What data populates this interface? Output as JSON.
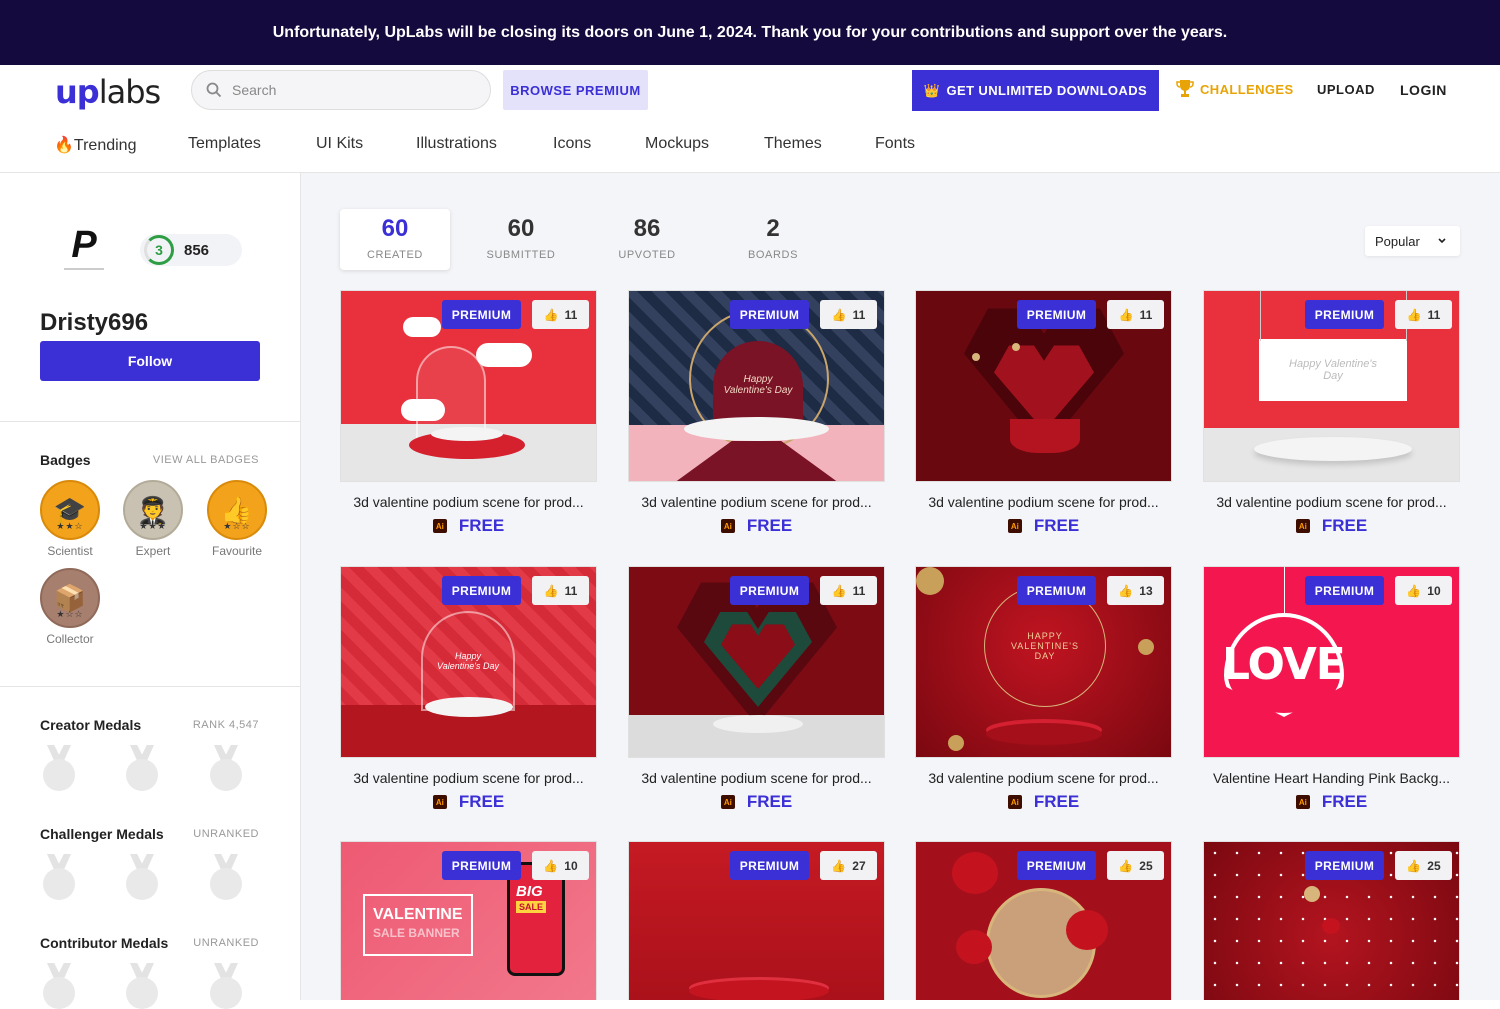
{
  "banner": {
    "text": "Unfortunately, UpLabs will be closing its doors on June 1, 2024. Thank you for your contributions and support over the years."
  },
  "header": {
    "logo_up": "up",
    "logo_labs": "labs",
    "search_placeholder": "Search",
    "browse_premium": "BROWSE PREMIUM",
    "get_unlimited": "GET UNLIMITED DOWNLOADS",
    "challenges": "CHALLENGES",
    "upload": "UPLOAD",
    "login": "LOGIN"
  },
  "categories": [
    "Trending",
    "Templates",
    "UI Kits",
    "Illustrations",
    "Icons",
    "Mockups",
    "Themes",
    "Fonts"
  ],
  "profile": {
    "avatar_letter": "P",
    "level": "3",
    "points": "856",
    "username": "Dristy696",
    "follow_label": "Follow"
  },
  "badges": {
    "title": "Badges",
    "view_all": "VIEW ALL BADGES",
    "items": [
      {
        "label": "Scientist",
        "icon": "graduation-cap-icon",
        "color": "#f2a21b"
      },
      {
        "label": "Expert",
        "icon": "expert-person-icon",
        "color": "#c9c2b2"
      },
      {
        "label": "Favourite",
        "icon": "thumbs-up-icon",
        "color": "#f2a21b"
      },
      {
        "label": "Collector",
        "icon": "box-icon",
        "color": "#a77f6e"
      }
    ]
  },
  "medals": {
    "creator": {
      "title": "Creator Medals",
      "rank": "RANK 4,547"
    },
    "challenger": {
      "title": "Challenger Medals",
      "rank": "UNRANKED"
    },
    "contributor": {
      "title": "Contributor Medals",
      "rank": "UNRANKED"
    }
  },
  "stats": [
    {
      "value": "60",
      "label": "CREATED"
    },
    {
      "value": "60",
      "label": "SUBMITTED"
    },
    {
      "value": "86",
      "label": "UPVOTED"
    },
    {
      "value": "2",
      "label": "BOARDS"
    }
  ],
  "sort": {
    "selected": "Popular"
  },
  "premium_label": "PREMIUM",
  "cards": [
    {
      "title": "3d valentine podium scene for prod...",
      "likes": "11",
      "price": "FREE",
      "file_type": "Ai"
    },
    {
      "title": "3d valentine podium scene for prod...",
      "likes": "11",
      "price": "FREE",
      "file_type": "Ai"
    },
    {
      "title": "3d valentine podium scene for prod...",
      "likes": "11",
      "price": "FREE",
      "file_type": "Ai"
    },
    {
      "title": "3d valentine podium scene for prod...",
      "likes": "11",
      "price": "FREE",
      "file_type": "Ai"
    },
    {
      "title": "3d valentine podium scene for prod...",
      "likes": "11",
      "price": "FREE",
      "file_type": "Ai"
    },
    {
      "title": "3d valentine podium scene for prod...",
      "likes": "11",
      "price": "FREE",
      "file_type": "Ai"
    },
    {
      "title": "3d valentine podium scene for prod...",
      "likes": "13",
      "price": "FREE",
      "file_type": "Ai"
    },
    {
      "title": "Valentine Heart Handing Pink Backg...",
      "likes": "10",
      "price": "FREE",
      "file_type": "Ai"
    },
    {
      "title": "",
      "likes": "10",
      "price": "",
      "file_type": ""
    },
    {
      "title": "",
      "likes": "27",
      "price": "",
      "file_type": ""
    },
    {
      "title": "",
      "likes": "25",
      "price": "",
      "file_type": ""
    },
    {
      "title": "",
      "likes": "25",
      "price": "",
      "file_type": ""
    }
  ],
  "thumb_text": {
    "valentine_script": "Happy Valentine's Day",
    "valentine_caps": "HAPPY VALENTINE'S DAY",
    "love": "LOVE",
    "sale_line1": "VALENTINE",
    "sale_line2": "SALE BANNER",
    "big": "BIG",
    "sale": "SALE"
  },
  "colors": {
    "accent": "#3b2fd6",
    "banner": "#150a3e",
    "challenge": "#e8a406"
  }
}
